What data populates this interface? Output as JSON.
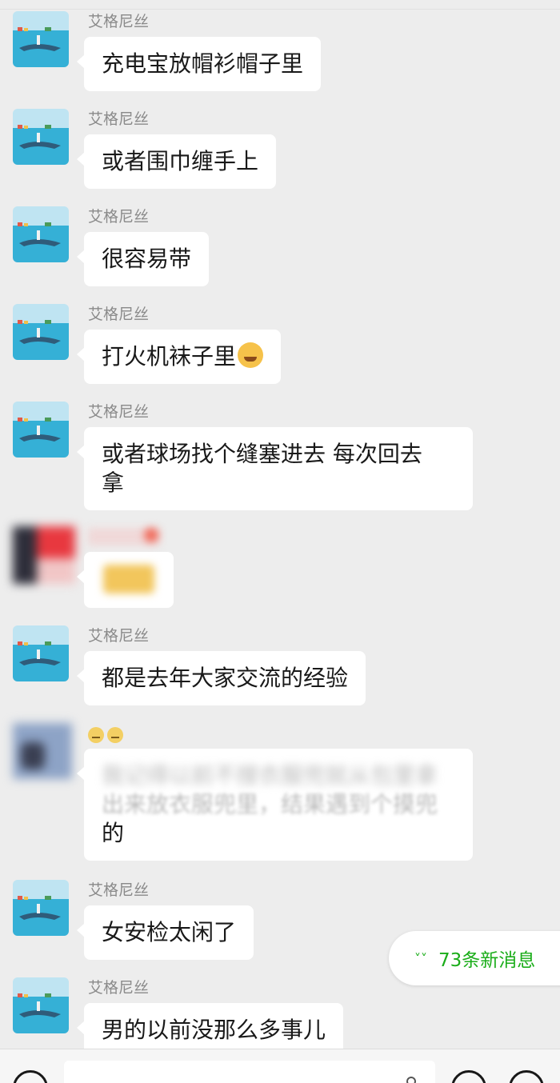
{
  "messages": [
    {
      "sender": "艾格尼丝",
      "text": "充电宝放帽衫帽子里"
    },
    {
      "sender": "艾格尼丝",
      "text": "或者围巾缠手上"
    },
    {
      "sender": "艾格尼丝",
      "text": "很容易带"
    },
    {
      "sender": "艾格尼丝",
      "text": "打火机袜子里"
    },
    {
      "sender": "艾格尼丝",
      "text_line1": "或者球场找个缝塞进去 每次回去",
      "text_line2": "拿"
    },
    {
      "sender": "艾格尼丝",
      "text": "都是去年大家交流的经验"
    },
    {
      "text_line1": "我记得以前不搜衣服兜就从包里拿",
      "text_line2": "出来放衣服兜里，结果遇到个摸兜",
      "text_line3": "的"
    },
    {
      "sender": "艾格尼丝",
      "text": "女安检太闲了"
    },
    {
      "sender": "艾格尼丝",
      "text": "男的以前没那么多事儿"
    }
  ],
  "new_messages": {
    "label": "73条新消息",
    "icon": "double-chevron-down-icon"
  },
  "icons": {
    "voice": "voice-icon",
    "emoji": "emoji-icon",
    "plus": "plus-icon",
    "wave": "wave-icon"
  },
  "colors": {
    "background": "#ededed",
    "bubble": "#ffffff",
    "accent": "#1aad19",
    "sender": "#8a8a8a"
  }
}
